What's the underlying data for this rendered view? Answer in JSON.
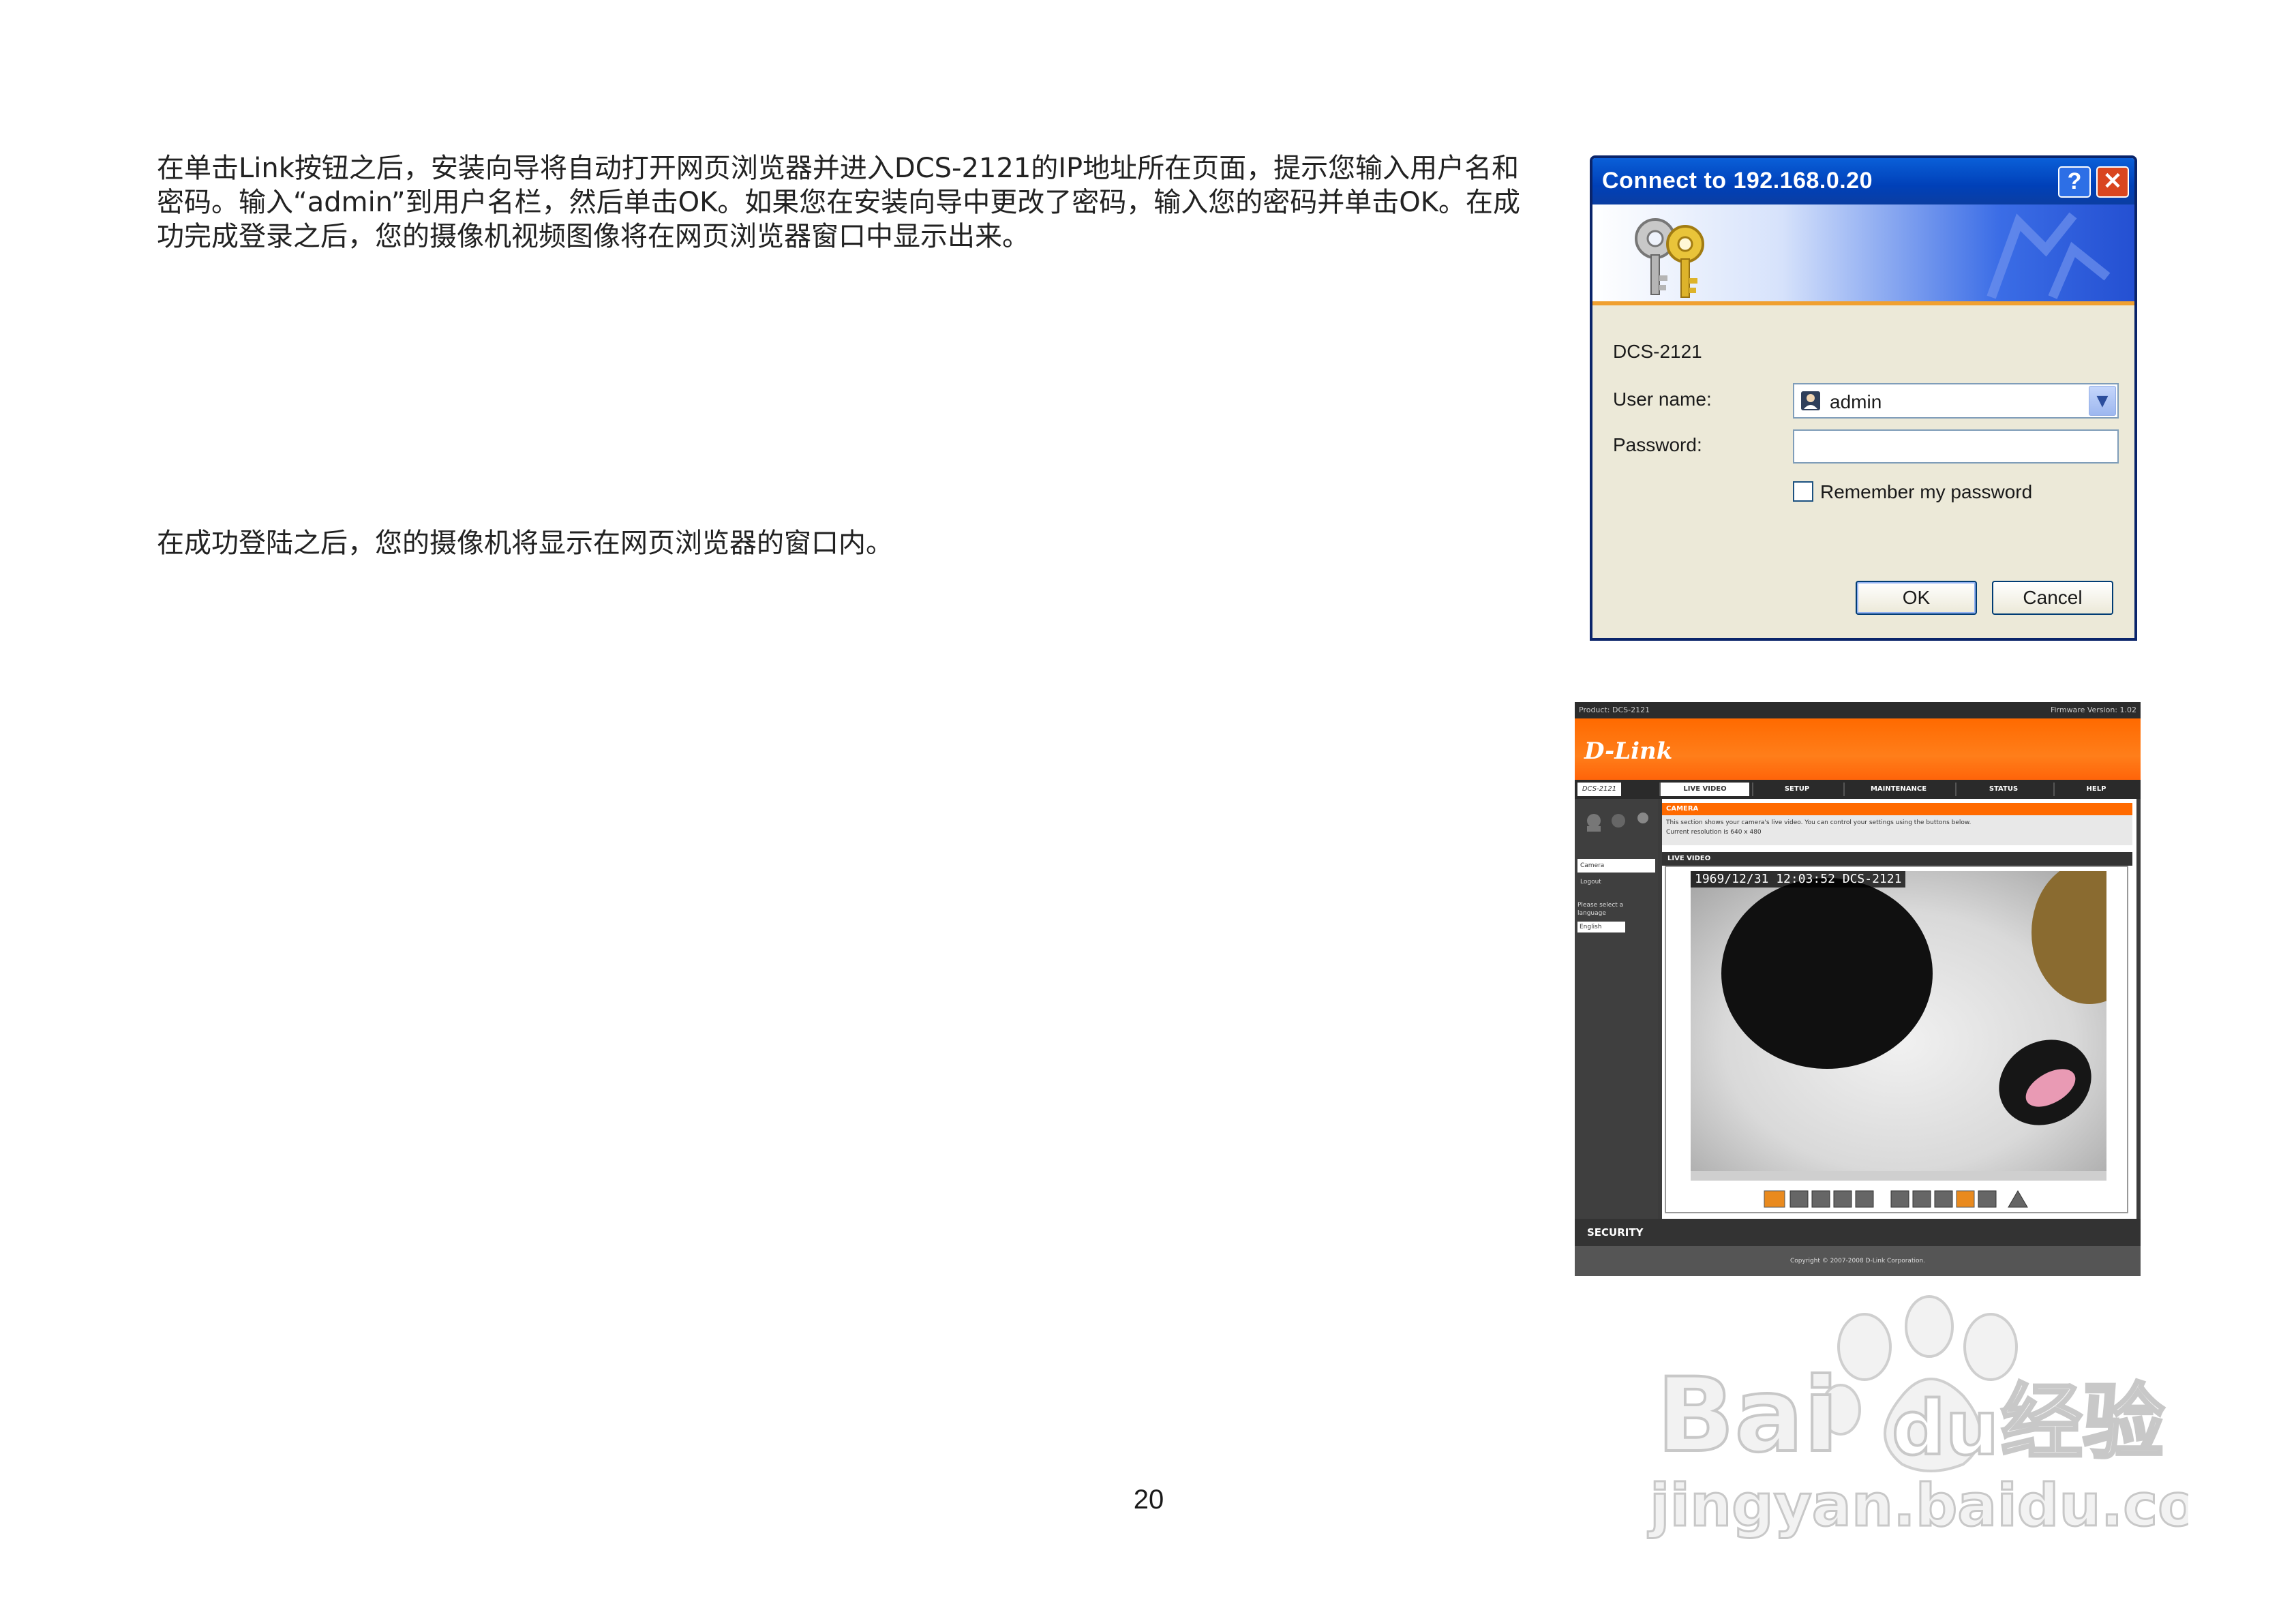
{
  "paragraphs": {
    "p1_line1": "在单击Link按钮之后，安装向导将自动打开网页浏览器并进入DCS-2121的IP地址所在页面，提示您输入用户名和",
    "p1_line2": "密码。输入“admin”到用户名栏，然后单击OK。如果您在安装向导中更改了密码，输入您的密码并单击OK。在成",
    "p1_line3": "功完成登录之后，您的摄像机视频图像将在网页浏览器窗口中显示出来。",
    "p2": "在成功登陆之后，您的摄像机将显示在网页浏览器的窗口内。"
  },
  "login_dialog": {
    "title": "Connect to 192.168.0.20",
    "help_button": "?",
    "close_button": "✕",
    "server_name": "DCS-2121",
    "username_label": "User name:",
    "username_value": "admin",
    "password_label": "Password:",
    "remember_label": "Remember my password",
    "remember_checked": false,
    "ok_label": "OK",
    "cancel_label": "Cancel",
    "icons": [
      "keys-icon",
      "user-icon",
      "chevron-down-icon"
    ]
  },
  "dlink_ui": {
    "product": "Product: DCS-2121",
    "firmware": "Firmware Version: 1.02",
    "logo": "D-Link",
    "model_badge": "DCS-2121",
    "tabs": [
      "LIVE VIDEO",
      "SETUP",
      "MAINTENANCE",
      "STATUS",
      "HELP"
    ],
    "active_tab": "LIVE VIDEO",
    "side_items": [
      "Camera",
      "Logout"
    ],
    "language_prompt": "Please select a language",
    "language_value": "English",
    "camera_heading": "CAMERA",
    "camera_desc_1": "This section shows your camera's live video. You can control your settings using the buttons below.",
    "camera_desc_2": "Current resolution is 640 x 480",
    "live_video_heading": "LIVE VIDEO",
    "osd_text": "1969/12/31 12:03:52 DCS-2121",
    "security_label": "SECURITY",
    "copyright": "Copyright © 2007-2008 D-Link Corporation.",
    "colors": {
      "orange": "#ff6a00",
      "dark": "#333333"
    }
  },
  "watermark": {
    "brand": "Bai",
    "brand2": "du",
    "cn_text": "经验",
    "url": "jingyan.baidu.com"
  },
  "page_number": "20"
}
